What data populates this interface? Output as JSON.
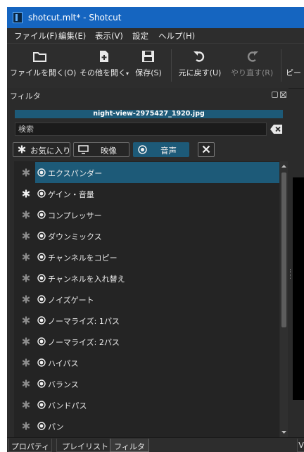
{
  "window": {
    "title": "shotcut.mlt* - Shotcut"
  },
  "menu": [
    "ファイル(F)",
    "編集(E)",
    "表示(V)",
    "設定",
    "ヘルプ(H)"
  ],
  "toolbar": {
    "open": "ファイルを開く(O)",
    "open_other": "その他を開く",
    "save": "保存(S)",
    "undo": "元に戻す(U)",
    "redo": "やり直す(R)",
    "peak": "ピー"
  },
  "panel": {
    "title": "フィルタ",
    "file_name": "night-view-2975427_1920.jpg",
    "search_placeholder": "検索",
    "tabs": {
      "favorites": "お気に入り",
      "video": "映像",
      "audio": "音声"
    },
    "filters": [
      {
        "name": "エクスパンダー",
        "selected": true,
        "favorite": false
      },
      {
        "name": "ゲイン・音量",
        "selected": false,
        "favorite": true
      },
      {
        "name": "コンプレッサー",
        "selected": false,
        "favorite": false
      },
      {
        "name": "ダウンミックス",
        "selected": false,
        "favorite": false
      },
      {
        "name": "チャンネルをコピー",
        "selected": false,
        "favorite": false
      },
      {
        "name": "チャンネルを入れ替え",
        "selected": false,
        "favorite": false
      },
      {
        "name": "ノイズゲート",
        "selected": false,
        "favorite": false
      },
      {
        "name": "ノーマライズ: 1パス",
        "selected": false,
        "favorite": false
      },
      {
        "name": "ノーマライズ: 2パス",
        "selected": false,
        "favorite": false
      },
      {
        "name": "ハイパス",
        "selected": false,
        "favorite": false
      },
      {
        "name": "バランス",
        "selected": false,
        "favorite": false
      },
      {
        "name": "バンドパス",
        "selected": false,
        "favorite": false
      },
      {
        "name": "パン",
        "selected": false,
        "favorite": false
      }
    ]
  },
  "bottom_tabs": [
    "プロパティ",
    "プレイリスト",
    "フィルタ",
    "V"
  ],
  "colors": {
    "accent": "#1d5a78",
    "titlebar": "#1565c0"
  }
}
